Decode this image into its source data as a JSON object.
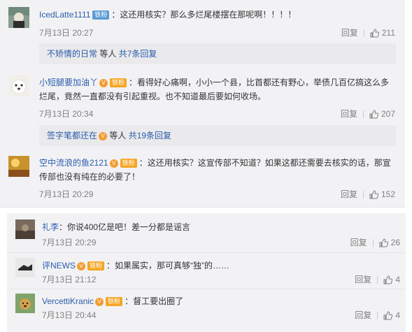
{
  "comments": [
    {
      "user": "IcedLatte1111",
      "badge": "铁粉",
      "text": "：这还用核实？那么多烂尾楼摆在那呢啊！！！！",
      "date": "7月13日 20:27",
      "reply_label": "回复",
      "likes": "211"
    },
    {
      "user": "小短腿要加油丫",
      "badge": "铁粉",
      "text": "：看得好心痛啊，小小一个县，比首都还有野心，举债几百亿搞这么多烂尾，竟然一直都没有引起重视。也不知道最后要如何收场。",
      "date": "7月13日 20:34",
      "reply_label": "回复",
      "likes": "207"
    },
    {
      "user": "空中流浪的鱼2121",
      "badge": "铁粉",
      "text": "：这还用核实？这宣传部不知道？如果这都还需要去核实的话，那宣传部也没有纯在的必要了！",
      "date": "7月13日 20:29",
      "reply_label": "回复",
      "likes": "152"
    }
  ],
  "reply_summaries": [
    {
      "who": "不矫情的日常",
      "mid": " 等人 ",
      "count": "共7条回复"
    },
    {
      "who": "签字笔都还在",
      "mid": " 等人 ",
      "count": "共19条回复"
    }
  ],
  "bottom_comments": [
    {
      "user": "礼李",
      "text": "：你说400亿是吧！差一分都是谣言",
      "date": "7月13日 20:29",
      "reply_label": "回复",
      "likes": "26"
    },
    {
      "user": "评NEWS",
      "badge": "铁粉",
      "text": "：如果属实，那可真够“独”的……",
      "date": "7月13日 21:12",
      "reply_label": "回复",
      "likes": "4"
    },
    {
      "user": "VercettiKranic",
      "badge": "铁粉",
      "text": "：督工要出圈了",
      "date": "7月13日 20:44",
      "reply_label": "回复",
      "likes": "4"
    }
  ],
  "colors": {
    "username": "#2a5cab",
    "meta": "#808080",
    "panel": "#f2f2f5",
    "reply_box": "#eaeaec"
  }
}
